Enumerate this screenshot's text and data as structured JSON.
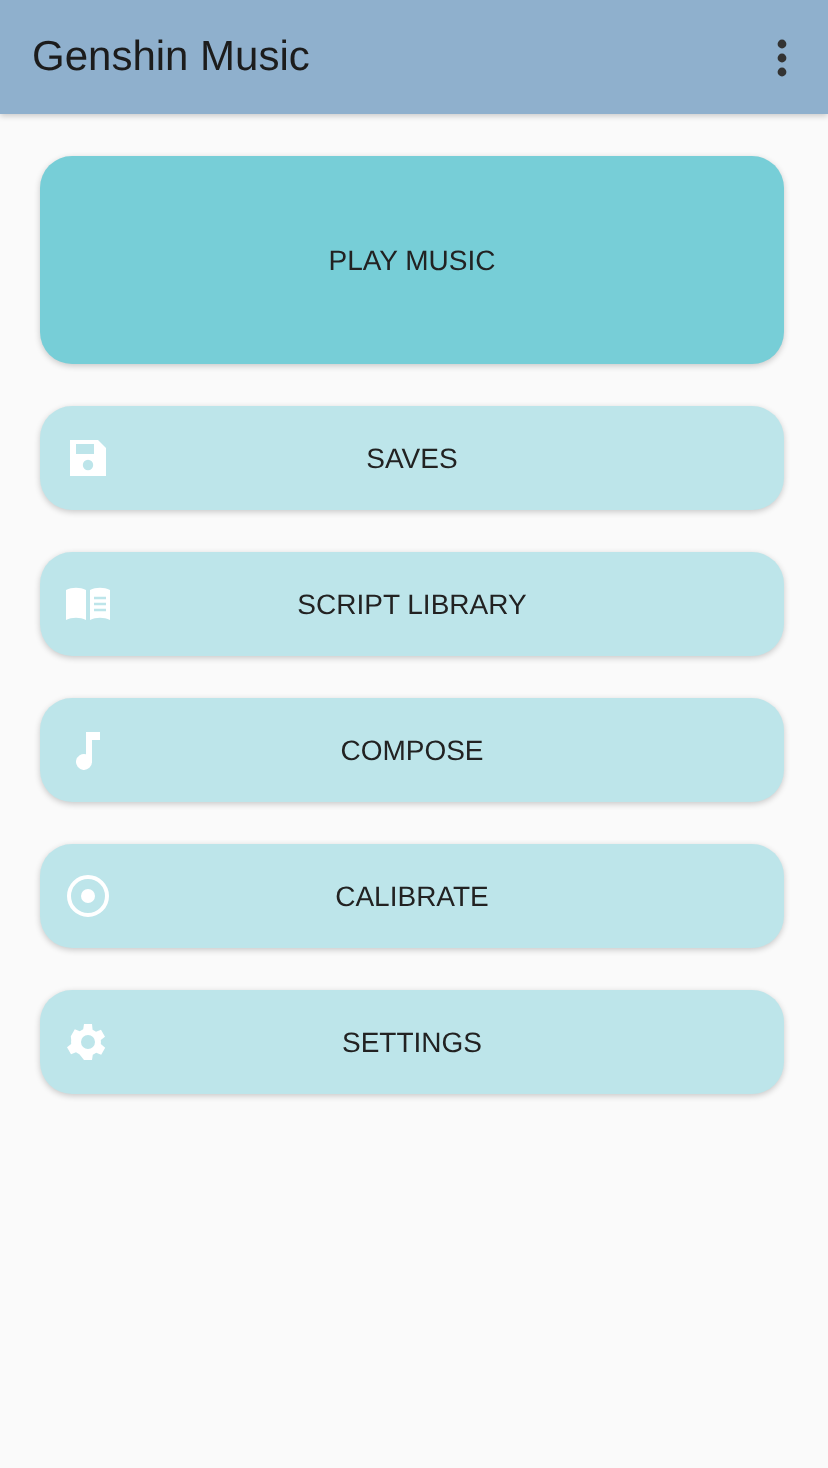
{
  "app_bar": {
    "title": "Genshin Music"
  },
  "main_button": {
    "label": "PLAY MUSIC"
  },
  "menu_buttons": [
    {
      "label": "SAVES",
      "kind": "save"
    },
    {
      "label": "SCRIPT LIBRARY",
      "kind": "library"
    },
    {
      "label": "COMPOSE",
      "kind": "compose"
    },
    {
      "label": "CALIBRATE",
      "kind": "calibrate"
    },
    {
      "label": "SETTINGS",
      "kind": "settings"
    }
  ]
}
